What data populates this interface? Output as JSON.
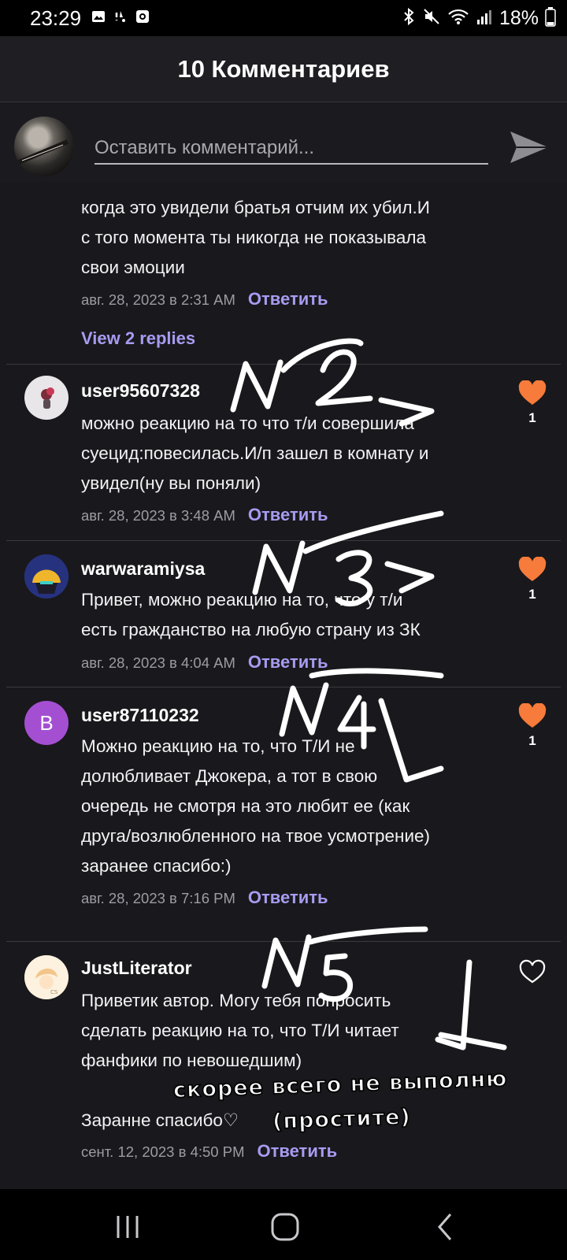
{
  "status_bar": {
    "time": "23:29",
    "battery": "18%",
    "left_icons": [
      "image-icon",
      "notification-icon",
      "screen-record-icon"
    ],
    "right_icons": [
      "bluetooth-icon",
      "mute-icon",
      "wifi-icon",
      "signal-icon",
      "battery-icon"
    ]
  },
  "header": {
    "title": "10 Комментариев"
  },
  "composer": {
    "placeholder": "Оставить комментарий..."
  },
  "comments": [
    {
      "text": "когда это увидели братья отчим их убил.И\nс того момента ты никогда не показывала\nсвои эмоции",
      "date": "авг. 28, 2023 в 2:31 AM",
      "reply_label": "Ответить",
      "view_replies": "View 2 replies"
    },
    {
      "username": "user95607328",
      "text": "можно реакцию на то что т/и совершила\nсуецид:повесилась.И/п зашел в комнату и\nувидел(ну вы поняли)",
      "date": "авг. 28, 2023 в 3:48 AM",
      "reply_label": "Ответить",
      "likes": "1",
      "liked": true
    },
    {
      "username": "warwaramiysa",
      "text": "Привет, можно реакцию на то, что у т/и\nесть гражданство на любую страну из ЗК",
      "date": "авг. 28, 2023 в 4:04 AM",
      "reply_label": "Ответить",
      "likes": "1",
      "liked": true
    },
    {
      "username": "user87110232",
      "avatar_letter": "B",
      "text": "Можно реакцию на то, что Т/И не\nдолюбливает Джокера, а тот в свою\nочередь не смотря на это любит ее (как\nдруга/возлюбленного на твое усмотрение)\nзаранее спасибо:)",
      "date": "авг. 28, 2023 в 7:16 PM",
      "reply_label": "Ответить",
      "likes": "1",
      "liked": true
    },
    {
      "username": "JustLiterator",
      "text": "Приветик автор. Могу тебя попросить\nсделать реакцию на то, что Т/И читает\nфанфики по невошедшим)\n\nЗаранне спасибо♡",
      "date": "сент. 12, 2023 в 4:50 PM",
      "reply_label": "Ответить",
      "liked": false
    }
  ],
  "handwritten": {
    "mark_2": "№2",
    "mark_3": "№3",
    "mark_4": "№4",
    "mark_5": "№5",
    "note_line1": "скорее всего не выполню",
    "note_line2": "(простите)"
  },
  "colors": {
    "background": "#19181c",
    "accent": "#a79bf0",
    "like": "#f77b3a",
    "avatar_purple": "#a44fd2"
  }
}
